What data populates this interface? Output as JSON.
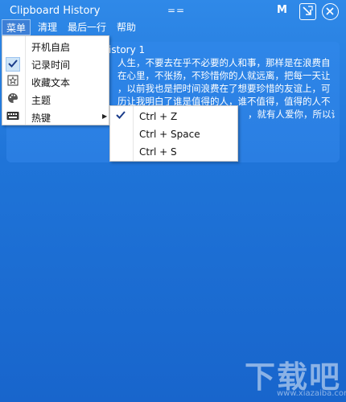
{
  "window": {
    "title": "Clipboard History",
    "center_mark": "==",
    "m_label": "M"
  },
  "menubar": {
    "items": [
      {
        "label": "菜单",
        "active": true
      },
      {
        "label": "清理"
      },
      {
        "label": "最后一行"
      },
      {
        "label": "帮助"
      }
    ]
  },
  "history": {
    "title": "History 1",
    "lines": [
      "人生，不要去在乎不必要的人和事，那样是在浪费自",
      "在心里，不张扬，不珍惜你的人就远离，把每一天让",
      "，以前我也是把时间浪费在了想要珍惜的友谊上，可",
      "历让我明白了谁是值得的人，谁不值得，值得的人不",
      "，就有人爱你，所以请"
    ]
  },
  "dropdown": {
    "items": [
      {
        "label": "开机自启",
        "icon": ""
      },
      {
        "label": "记录时间",
        "icon": "check-icon",
        "checked": true
      },
      {
        "label": "收藏文本",
        "icon": "star-box-icon"
      },
      {
        "label": "主题",
        "icon": "palette-icon"
      },
      {
        "label": "热键",
        "icon": "keyboard-icon",
        "has_submenu": true
      }
    ]
  },
  "submenu": {
    "items": [
      {
        "label": "Ctrl + Z",
        "checked": true
      },
      {
        "label": "Ctrl + Space"
      },
      {
        "label": "Ctrl + S"
      }
    ]
  },
  "watermark": {
    "text": "下载吧",
    "url": "www.xiazaiba.com"
  }
}
